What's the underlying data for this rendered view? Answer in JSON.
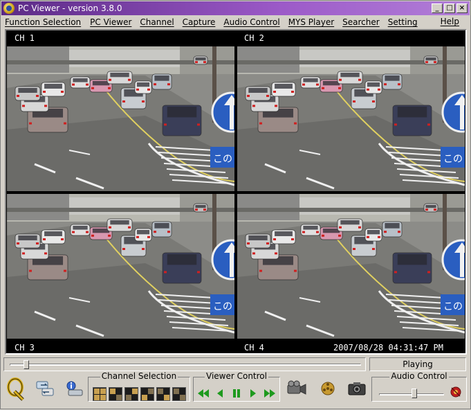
{
  "window": {
    "title": "PC Viewer - version 3.8.0",
    "btn_minimize": "_",
    "btn_maximize": "□",
    "btn_close": "×"
  },
  "menu": {
    "items": [
      "Function Selection",
      "PC Viewer",
      "Channel",
      "Capture",
      "Audio Control",
      "MYS Player",
      "Searcher",
      "Setting"
    ],
    "help": "Help"
  },
  "viewer": {
    "channels": [
      "CH 1",
      "CH 2",
      "CH 3",
      "CH 4"
    ],
    "timestamp": "2007/08/28 04:31:47 PM",
    "sign_text": "この"
  },
  "playback": {
    "status": "Playing",
    "position": 0.04
  },
  "controls": {
    "channel_selection_label": "Channel Selection",
    "viewer_control_label": "Viewer Control",
    "audio_control_label": "Audio Control",
    "audio_level": 0.55
  },
  "colors": {
    "title_gradient_start": "#5b2a86",
    "button_face": "#d4d0c8",
    "play_green": "#1e9a1e"
  },
  "icons": [
    "q-logo-icon",
    "switch-icon",
    "info-icon",
    "camcorder-icon",
    "film-reel-icon",
    "camera-icon",
    "speaker-icon"
  ]
}
